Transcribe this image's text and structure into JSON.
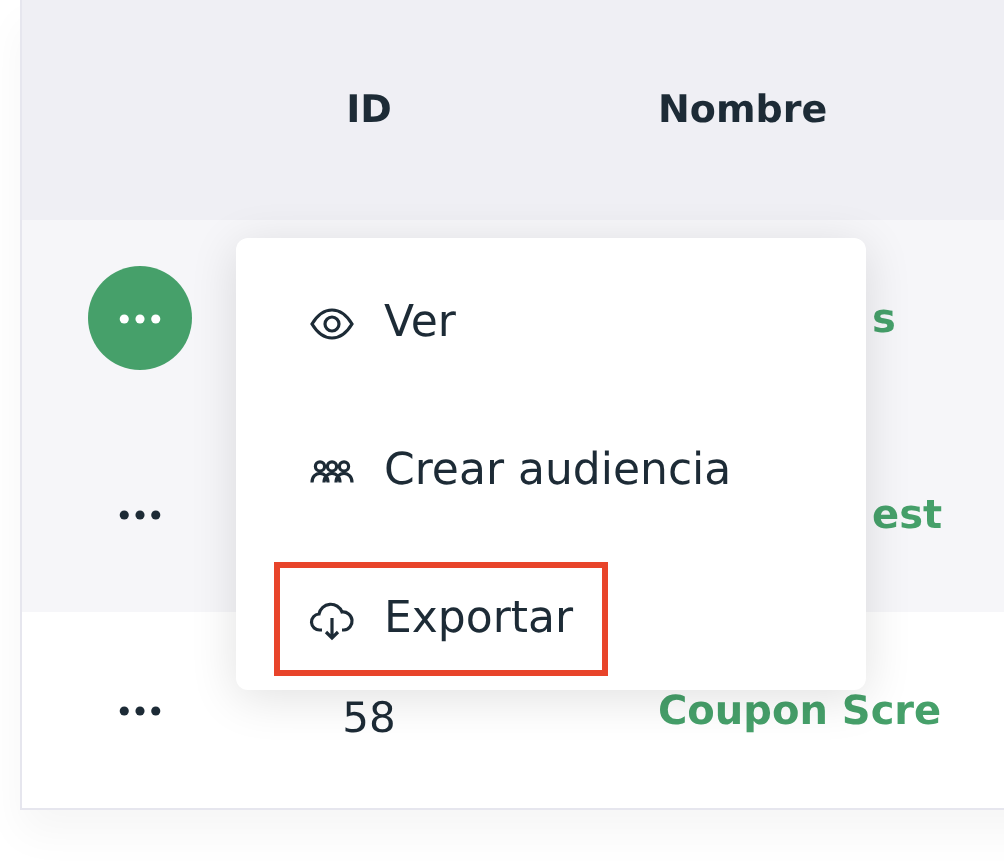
{
  "table": {
    "columns": [
      {
        "label": "ID"
      },
      {
        "label": "Nombre"
      }
    ],
    "rows": [
      {
        "menu_open": true,
        "name_behind_menu": true,
        "name": "s"
      },
      {
        "menu_open": false,
        "name_behind_menu": true,
        "name": "est"
      },
      {
        "menu_open": false,
        "name_behind_menu": false,
        "id": "58",
        "name": "Coupon Scre"
      }
    ]
  },
  "menu": {
    "items": [
      {
        "kind": "view",
        "label": "Ver",
        "highlighted": false
      },
      {
        "kind": "audience",
        "label": "Crear audiencia",
        "highlighted": false
      },
      {
        "kind": "export",
        "label": "Exportar",
        "highlighted": true
      }
    ]
  }
}
